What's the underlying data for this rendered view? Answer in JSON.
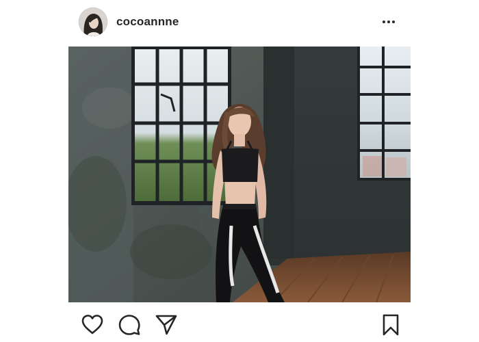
{
  "post": {
    "username": "cocoannne",
    "avatar_icon": "profile-photo",
    "more_icon": "more-options-icon",
    "photo_alt": "photo",
    "actions": {
      "like_icon": "heart-icon",
      "comment_icon": "comment-icon",
      "share_icon": "direct-share-icon",
      "save_icon": "bookmark-icon"
    }
  },
  "colors": {
    "text": "#262626",
    "icon": "#262626",
    "background": "#ffffff"
  }
}
